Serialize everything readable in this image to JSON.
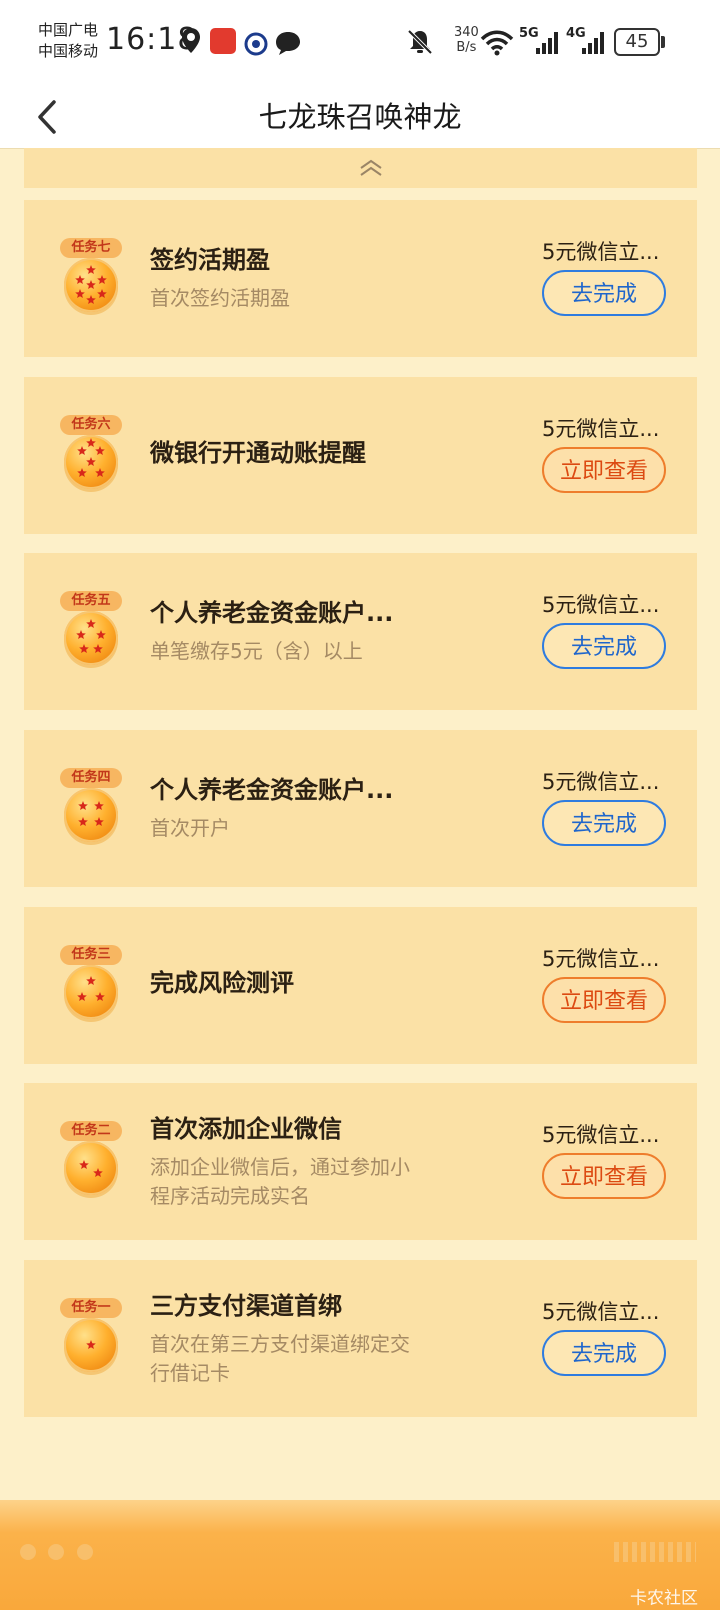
{
  "status_bar": {
    "carrier_1": "中国广电",
    "carrier_2": "中国移动",
    "time": "16:18",
    "net_speed_value": "340",
    "net_speed_unit": "B/s",
    "signal_1_label": "5G",
    "signal_2_label": "4G",
    "battery": "45",
    "icons": [
      "location-icon",
      "app-notification-icon",
      "app-notification-icon-2",
      "message-icon",
      "mute-bell-icon",
      "wifi-icon",
      "signal-icon",
      "battery-icon"
    ]
  },
  "nav": {
    "title": "七龙珠召唤神龙",
    "back_icon": "chevron-left-icon"
  },
  "collapse_icon": "double-chevron-up-icon",
  "tasks": [
    {
      "tag": "任务七",
      "stars": 7,
      "title": "签约活期盈",
      "desc": "首次签约活期盈",
      "reward": "5元微信立...",
      "button": "去完成",
      "button_style": "blue"
    },
    {
      "tag": "任务六",
      "stars": 6,
      "title": "微银行开通动账提醒",
      "desc": "",
      "reward": "5元微信立...",
      "button": "立即查看",
      "button_style": "orange"
    },
    {
      "tag": "任务五",
      "stars": 5,
      "title": "个人养老金资金账户...",
      "desc": "单笔缴存5元（含）以上",
      "reward": "5元微信立...",
      "button": "去完成",
      "button_style": "blue"
    },
    {
      "tag": "任务四",
      "stars": 4,
      "title": "个人养老金资金账户...",
      "desc": "首次开户",
      "reward": "5元微信立...",
      "button": "去完成",
      "button_style": "blue"
    },
    {
      "tag": "任务三",
      "stars": 3,
      "title": "完成风险测评",
      "desc": "",
      "reward": "5元微信立...",
      "button": "立即查看",
      "button_style": "orange"
    },
    {
      "tag": "任务二",
      "stars": 2,
      "title": "首次添加企业微信",
      "desc": "添加企业微信后，通过参加小程序活动完成实名",
      "reward": "5元微信立...",
      "button": "立即查看",
      "button_style": "orange"
    },
    {
      "tag": "任务一",
      "stars": 1,
      "title": "三方支付渠道首绑",
      "desc": "首次在第三方支付渠道绑定交行借记卡",
      "reward": "5元微信立...",
      "button": "去完成",
      "button_style": "blue"
    }
  ],
  "watermark": "卡农社区",
  "colors": {
    "page_bg": "#fdf0c9",
    "card_bg": "#fbe1a6",
    "button_blue": "#1f66cc",
    "button_orange": "#dc4a12",
    "tag_text": "#c2371a"
  }
}
